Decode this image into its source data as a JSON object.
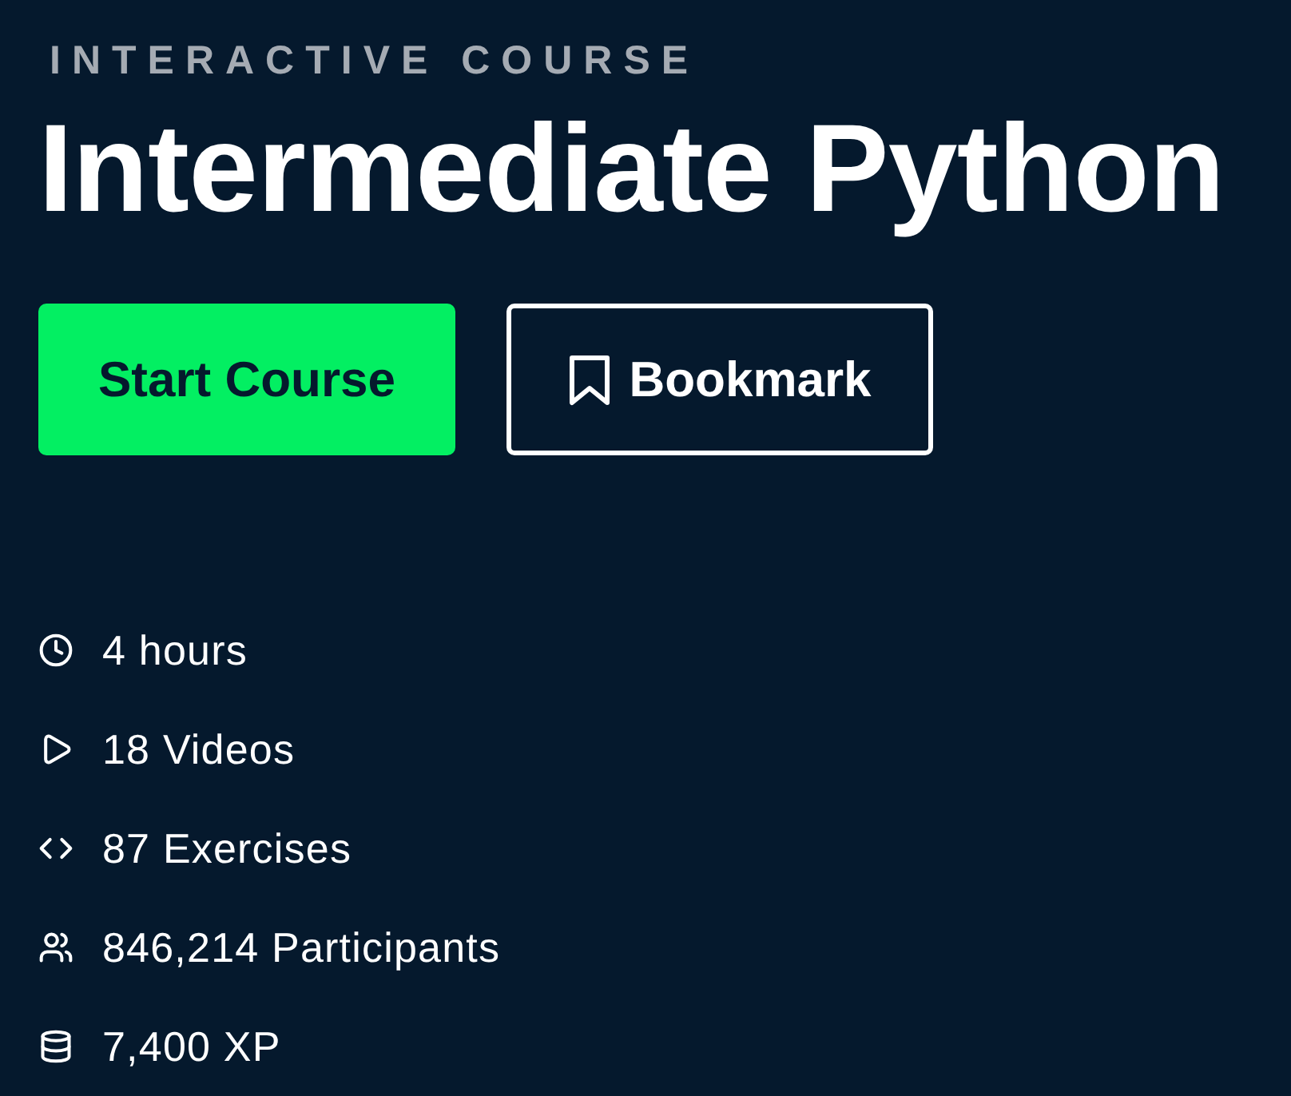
{
  "eyebrow": "INTERACTIVE COURSE",
  "title": "Intermediate Python",
  "actions": [
    {
      "kind": "primary",
      "label": "Start Course"
    },
    {
      "kind": "bookmark",
      "label": "Bookmark"
    }
  ],
  "stats": [
    {
      "kind": "duration",
      "text": "4 hours"
    },
    {
      "kind": "videos",
      "text": "18 Videos"
    },
    {
      "kind": "exercises",
      "text": "87 Exercises"
    },
    {
      "kind": "participants",
      "text": "846,214 Participants"
    },
    {
      "kind": "xp",
      "text": "7,400 XP"
    }
  ]
}
